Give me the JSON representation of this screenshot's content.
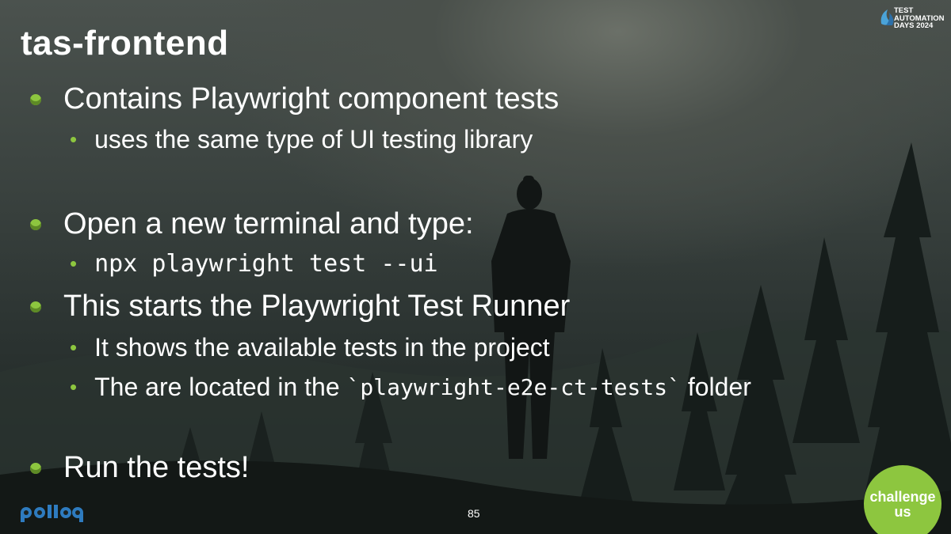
{
  "slide": {
    "title": "tas-frontend",
    "bullets": [
      {
        "text": "Contains Playwright component tests",
        "sub": [
          "uses the same type of UI testing library"
        ]
      },
      {
        "text": "Open a new terminal and type:",
        "sub": [
          "npx playwright test --ui"
        ]
      },
      {
        "text": "This starts the Playwright Test Runner",
        "sub": [
          "It shows the available tests in the project",
          "The are located in the",
          "`playwright-e2e-ct-tests`",
          "folder"
        ]
      },
      {
        "text": "Run the tests!"
      }
    ],
    "page_number": "85"
  },
  "logos": {
    "event_logo": {
      "line1": "TEST",
      "line2": "AUTOMATION",
      "line3": "DAYS 2024"
    },
    "company_logo": "polleq",
    "badge": {
      "line1": "challenge",
      "line2": "us"
    }
  },
  "colors": {
    "accent_green": "#8dc63f",
    "text": "#ffffff"
  }
}
